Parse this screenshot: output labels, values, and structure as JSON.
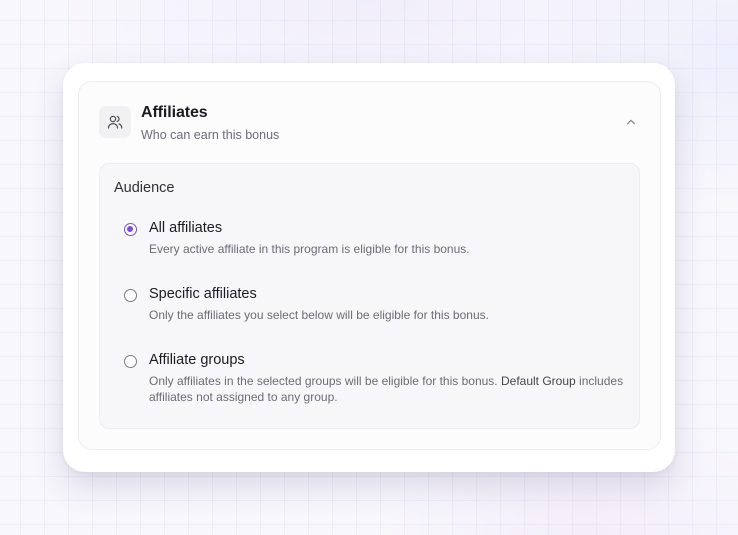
{
  "section": {
    "title": "Affiliates",
    "subtitle": "Who can earn this bonus",
    "icon": "users-icon",
    "collapse_icon": "chevron-up-icon"
  },
  "audience": {
    "label": "Audience",
    "selected": "all",
    "accent_color": "#7c4ddf",
    "options": [
      {
        "id": "all",
        "label": "All affiliates",
        "description": "Every active affiliate in this program is eligible for this bonus."
      },
      {
        "id": "specific",
        "label": "Specific affiliates",
        "description": "Only the affiliates you select below will be eligible for this bonus."
      },
      {
        "id": "groups",
        "label": "Affiliate groups",
        "description": "Only affiliates in the selected groups will be eligible for this bonus.",
        "description_strong": "Default Group",
        "description_tail": "includes affiliates not assigned to any group."
      }
    ]
  }
}
